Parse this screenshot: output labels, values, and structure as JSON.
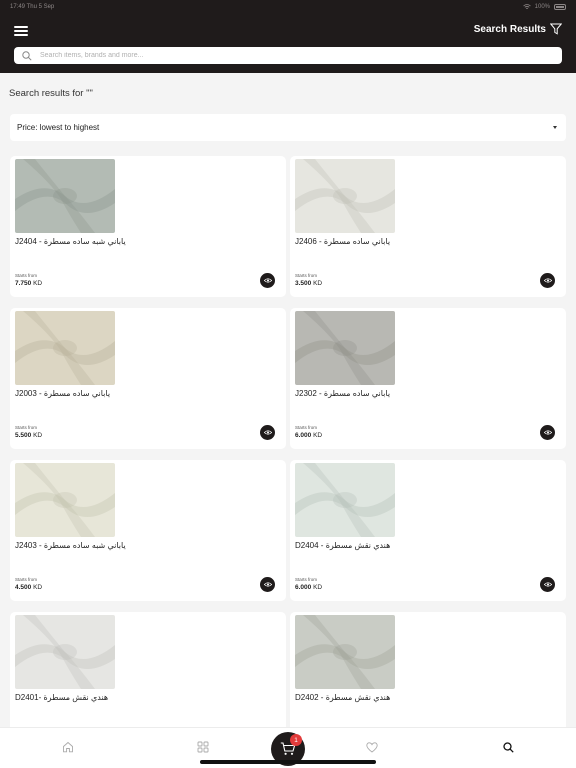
{
  "status_bar": {
    "time": "17:49",
    "date": "Thu 5 Sep",
    "battery": "100%"
  },
  "header": {
    "title": "Search Results"
  },
  "search": {
    "placeholder": "Search items, brands and more..."
  },
  "results_label": "Search results for \"\"",
  "sort": {
    "selected": "Price: lowest to highest"
  },
  "products": [
    {
      "name": "J2404 - ياباني شبه ساده مسطرة",
      "from_label": "Starts from",
      "price": "7.750",
      "currency": "KD",
      "color": "#b3bbb4",
      "shade": "#8a948c"
    },
    {
      "name": "J2406 - ياباني ساده مسطرة",
      "from_label": "Starts from",
      "price": "3.500",
      "currency": "KD",
      "color": "#e6e6e0",
      "shade": "#bcbcb4"
    },
    {
      "name": "J2003 - ياباني ساده مسطرة",
      "from_label": "Starts from",
      "price": "5.500",
      "currency": "KD",
      "color": "#dcd6c3",
      "shade": "#b5ae98"
    },
    {
      "name": "J2302 - ياباني ساده مسطرة",
      "from_label": "Starts from",
      "price": "6.000",
      "currency": "KD",
      "color": "#b8b8b3",
      "shade": "#8e8e88"
    },
    {
      "name": "J2403 - ياباني شبه ساده مسطرة",
      "from_label": "Starts from",
      "price": "4.500",
      "currency": "KD",
      "color": "#e7e6d8",
      "shade": "#c1bfac"
    },
    {
      "name": "D2404 - هندي نقش مسطرة",
      "from_label": "Starts from",
      "price": "6.000",
      "currency": "KD",
      "color": "#dfe6e0",
      "shade": "#b3beb5"
    },
    {
      "name": "D2401- هندي نقش مسطرة",
      "from_label": "",
      "price": "",
      "currency": "",
      "color": "#e6e6e3",
      "shade": "#bdbdb8"
    },
    {
      "name": "D2402 - هندي نقش مسطرة",
      "from_label": "",
      "price": "",
      "currency": "",
      "color": "#c9ccc5",
      "shade": "#9da096"
    }
  ],
  "nav": {
    "cart_count": "1"
  },
  "colors": {
    "header_bg": "#1f1b1b",
    "badge": "#e23b3b",
    "page_bg": "#f4f4f4"
  }
}
